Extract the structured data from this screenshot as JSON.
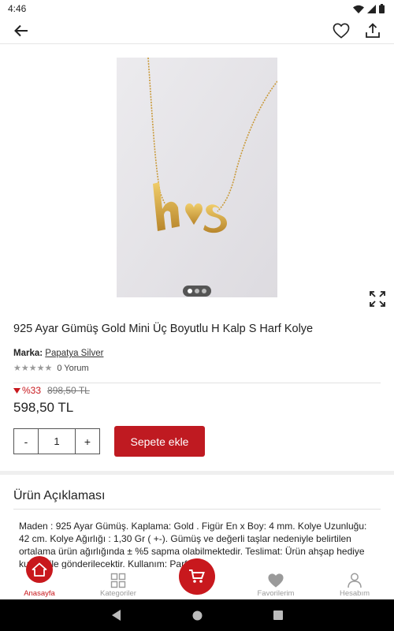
{
  "status_bar": {
    "time": "4:46"
  },
  "product": {
    "title": "925 Ayar Gümüş Gold Mini Üç Boyutlu H Kalp S Harf Kolye",
    "brand_label": "Marka:",
    "brand_name": "Papatya Silver",
    "reviews": "0 Yorum",
    "rating_stars": 0,
    "discount": "%33",
    "old_price": "898,50 TL",
    "price": "598,50 TL",
    "image_count": 3,
    "image_active_index": 0
  },
  "quantity": {
    "minus": "-",
    "value": "1",
    "plus": "+"
  },
  "add_to_cart_label": "Sepete ekle",
  "description": {
    "title": "Ürün Açıklaması",
    "body": "Maden : 925 Ayar Gümüş. Kaplama: Gold . Figür En x Boy: 4 mm. Kolye Uzunluğu: 42 cm. Kolye Ağırlığı : 1,30 Gr ( +-). Gümüş ve değerli taşlar nedeniyle belirtilen ortalama ürün ağırlığında ± %5 sapma olabilmektedir. Teslimat: Ürün ahşap hediye kutusu ile gönderilecektir. Kullanım: Parfüm"
  },
  "bottom_nav": {
    "home": "Anasayfa",
    "categories": "Kategoriler",
    "favorites": "Favorilerim",
    "account": "Hesabım"
  },
  "colors": {
    "accent": "#c8181d",
    "button": "#bf1a21"
  },
  "icons": [
    "back-arrow-icon",
    "heart-outline-icon",
    "share-icon",
    "expand-icon",
    "home-icon",
    "grid-icon",
    "cart-icon",
    "heart-icon",
    "person-icon"
  ]
}
